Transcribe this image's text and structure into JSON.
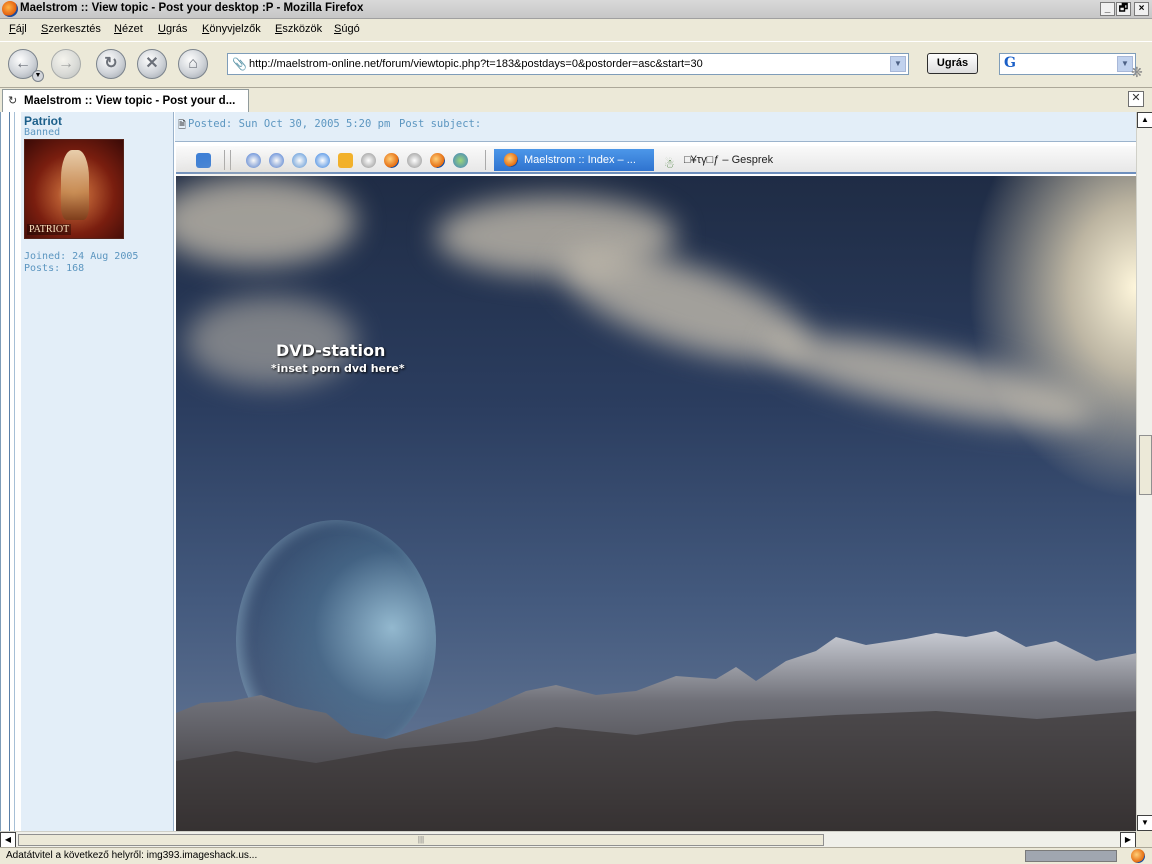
{
  "window": {
    "title": "Maelstrom :: View topic - Post your desktop :P - Mozilla Firefox",
    "min": "_",
    "max": "🗗",
    "close": "×"
  },
  "menu": [
    "Fájl",
    "Szerkesztés",
    "Nézet",
    "Ugrás",
    "Könyvjelzők",
    "Eszközök",
    "Súgó"
  ],
  "nav": {
    "url": "http://maelstrom-online.net/forum/viewtopic.php?t=183&postdays=0&postorder=asc&start=30",
    "go_label": "Ugrás",
    "search_logo": "G"
  },
  "tab": {
    "label": "Maelstrom :: View topic - Post your d..."
  },
  "post": {
    "author": "Patriot",
    "rank": "Banned",
    "avatar_signature": "PATRIOT",
    "joined": "Joined: 24 Aug 2005",
    "posts": "Posts: 168",
    "posted": "Posted: Sun Oct 30, 2005 5:20 pm",
    "subject": "Post subject:"
  },
  "desktop": {
    "task1": "Maelstrom :: Index – ...",
    "task2": "□¥τγ□ƒ – Gesprek",
    "dvd_title": "DVD-station",
    "dvd_subtitle": "*inset porn dvd here*"
  },
  "status": {
    "text": "Adatátvitel a következő helyről: img393.imageshack.us..."
  },
  "colors": {
    "accent_blue": "#2f73cf",
    "forum_blue": "#5c96c0",
    "forum_bg": "#e3eef8"
  }
}
